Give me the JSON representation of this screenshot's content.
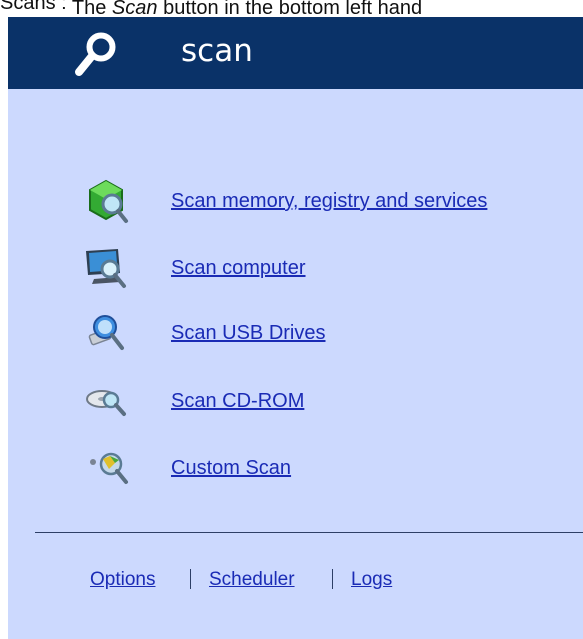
{
  "caption": {
    "prefix": "Scans :",
    "text_before": " The ",
    "italic": "Scan",
    "text_after": " button in the bottom left hand"
  },
  "header": {
    "title": "scan",
    "icon": "magnifier-icon",
    "background": "#0a3268"
  },
  "scan_items": [
    {
      "label": "Scan memory, registry and services",
      "icon": "memory-scan-icon"
    },
    {
      "label": "Scan computer",
      "icon": "computer-scan-icon"
    },
    {
      "label": "Scan USB Drives",
      "icon": "usb-scan-icon"
    },
    {
      "label": "Scan CD-ROM",
      "icon": "cdrom-scan-icon"
    },
    {
      "label": "Custom Scan",
      "icon": "custom-scan-icon"
    }
  ],
  "footer": {
    "links": [
      {
        "label": "Options"
      },
      {
        "label": "Scheduler"
      },
      {
        "label": "Logs"
      }
    ]
  },
  "colors": {
    "panel_background": "#ccd9fe",
    "link": "#1a2bb5"
  }
}
